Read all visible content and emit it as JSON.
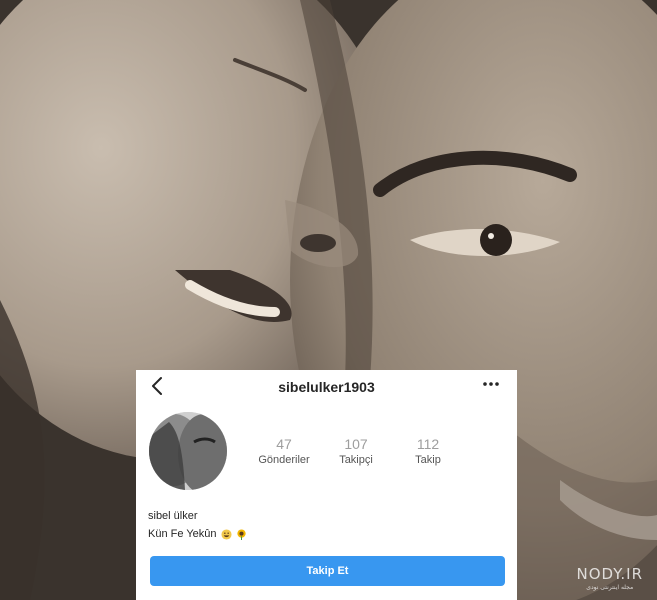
{
  "profile": {
    "username": "sibelulker1903",
    "stats": [
      {
        "count": "47",
        "label": "Gönderiler"
      },
      {
        "count": "107",
        "label": "Takipçi"
      },
      {
        "count": "112",
        "label": "Takip"
      }
    ],
    "name": "sibel ülker",
    "bio": "Kün Fe Yekûn",
    "bio_emojis": [
      "grinning-face-emoji",
      "sunflower-emoji"
    ],
    "follow_label": "Takip Et"
  },
  "watermark": {
    "main": "NODY.IR",
    "sub": "مجله اینترنتی نودی"
  },
  "colors": {
    "follow_button": "#3897f0",
    "card_background": "#ffffff",
    "stat_count": "#9e9e9e"
  },
  "icons": {
    "back": "chevron-left-icon",
    "more": "more-icon"
  }
}
